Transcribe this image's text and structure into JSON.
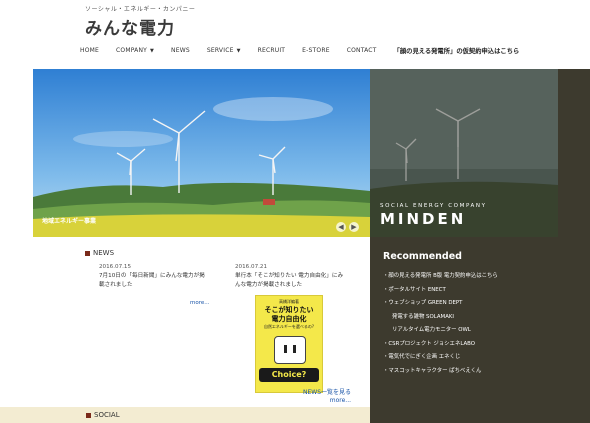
{
  "brand": {
    "tagline": "ソーシャル・エネルギー・カンパニー",
    "logo": "みんな電力"
  },
  "nav": {
    "items": [
      {
        "label": "HOME",
        "dropdown": false
      },
      {
        "label": "COMPANY",
        "dropdown": true
      },
      {
        "label": "NEWS",
        "dropdown": false
      },
      {
        "label": "SERVICE",
        "dropdown": true
      },
      {
        "label": "RECRUIT",
        "dropdown": false
      },
      {
        "label": "E-STORE",
        "dropdown": false
      },
      {
        "label": "CONTACT",
        "dropdown": false
      }
    ],
    "promo": "「顔の見える発電所」の仮契約申込はこちら"
  },
  "hero": {
    "caption": "地域エネルギー事業",
    "prev_arrow": "◀",
    "next_arrow": "▶",
    "mind_sub": "SOCIAL ENERGY COMPANY",
    "mind_main": "MINDEN"
  },
  "news": {
    "title": "NEWS",
    "items": [
      {
        "date": "2016.07.15",
        "text_line1": "7月10日の「毎日新聞」にみんな電力が掲",
        "text_line2": "載されました",
        "more": "more..."
      },
      {
        "date": "2016.07.21",
        "text_line1": "単行本「そこが知りたい 電力自由化」にみ",
        "text_line2": "んな電力が掲載されました",
        "more": "more..."
      }
    ],
    "book": {
      "top": "高橋洋編著",
      "head_line1": "そこが知りたい",
      "head_line2": "電力自由化",
      "sub": "自然エネルギーを選べるの?",
      "choice": "Choice?"
    },
    "all_line1": "NEWS一覧を見る",
    "all_line2": "more..."
  },
  "social": {
    "title": "SOCIAL"
  },
  "recommended": {
    "title": "Recommended",
    "items": [
      {
        "label": "・顔の見える発電所 B版 電力契約申込はこちら",
        "sub": false
      },
      {
        "label": "・ポータルサイト ENECT",
        "sub": false
      },
      {
        "label": "・ウェブショップ GREEN DEPT",
        "sub": false
      },
      {
        "label": "発電する雑物 SOLAMAKI",
        "sub": true
      },
      {
        "label": "リアルタイム電力モニター OWL",
        "sub": true
      },
      {
        "label": "・CSRプロジェクト ジョシエネLABO",
        "sub": false
      },
      {
        "label": "・電気代でにぎく企画 エネくじ",
        "sub": false
      },
      {
        "label": "・マスコットキャラクター ぱちべえくん",
        "sub": false
      }
    ]
  }
}
